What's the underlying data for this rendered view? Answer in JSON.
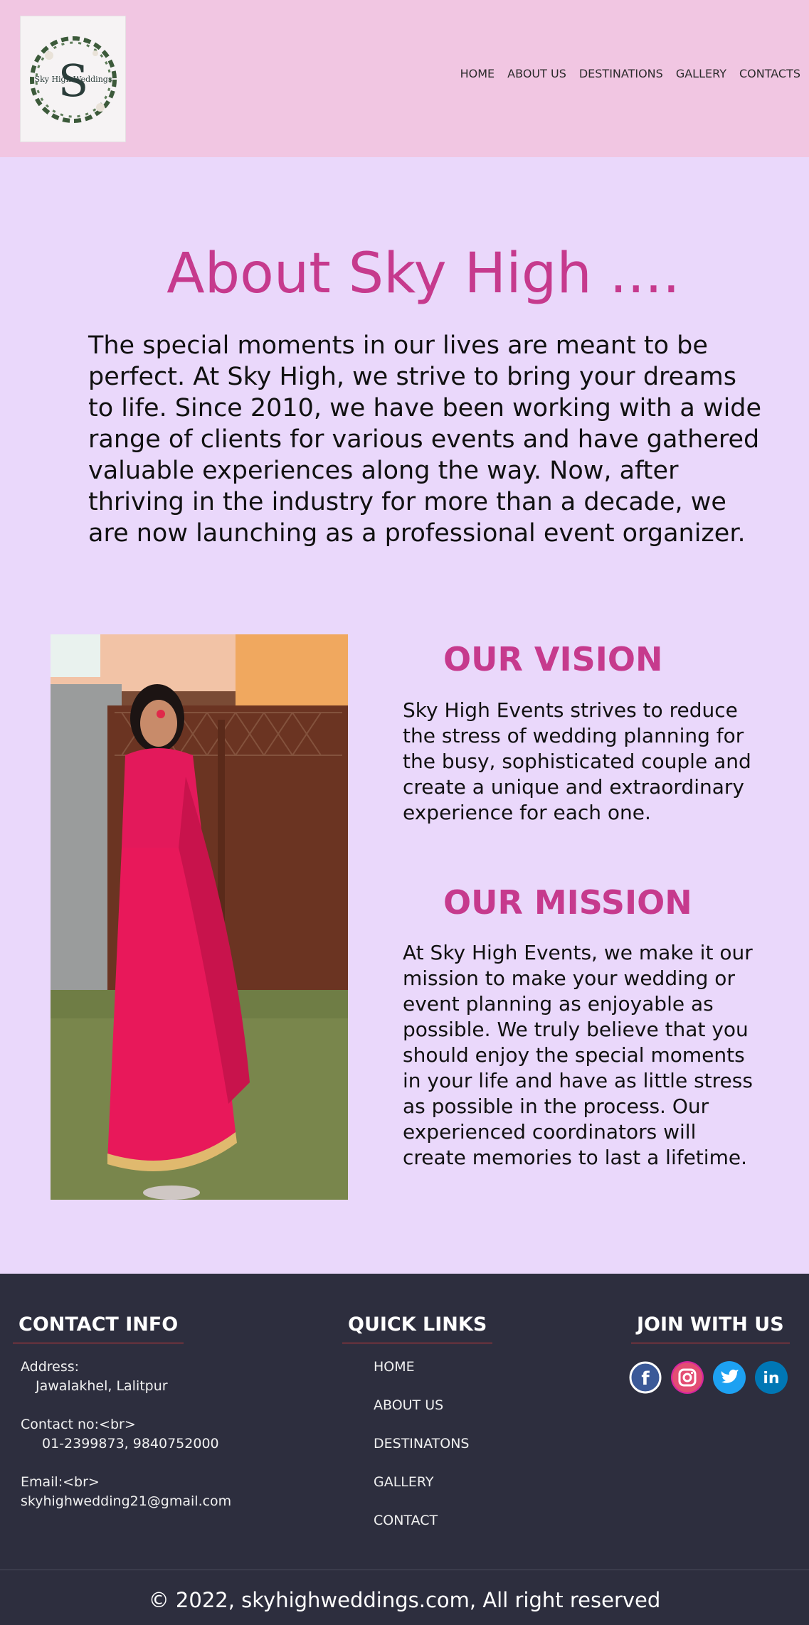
{
  "header": {
    "logo_text": "Sky High Weddings",
    "nav": [
      {
        "label": "HOME"
      },
      {
        "label": "ABOUT US"
      },
      {
        "label": "DESTINATIONS"
      },
      {
        "label": "GALLERY"
      },
      {
        "label": "CONTACTS"
      }
    ]
  },
  "about": {
    "title": "About Sky High ....",
    "text": "The special moments in our lives are meant to be perfect. At Sky High, we strive to bring your dreams to life. Since 2010, we have been working with a wide range of clients for various events and have gathered valuable experiences along the way. Now, after thriving in the industry for more than  a decade, we are now launching as a professional event organizer."
  },
  "vision": {
    "title": "OUR VISION",
    "text": "Sky High Events strives to reduce the stress of wedding planning for the busy, sophisticated couple and create a unique and extraordinary experience for each one."
  },
  "mission": {
    "title": "OUR MISSION",
    "text": "At Sky High Events, we make it our mission to make your wedding or event planning as enjoyable as possible. We truly believe that you should enjoy the special moments in your life and have as little stress as possible in the process. Our experienced coordinators will create memories to last a lifetime."
  },
  "footer": {
    "contact_title": "CONTACT INFO",
    "address_label": "Address:",
    "address_value": "Jawalakhel, Lalitpur",
    "contact_label": "Contact no:<br>",
    "contact_value": "01-2399873, 9840752000",
    "email_label": "Email:<br>",
    "email_value": "skyhighwedding21@gmail.com",
    "links_title": "QUICK LINKS",
    "links": [
      {
        "label": "HOME"
      },
      {
        "label": "ABOUT US"
      },
      {
        "label": "DESTINATONS"
      },
      {
        "label": "GALLERY"
      },
      {
        "label": "CONTACT"
      }
    ],
    "join_title": "JOIN WITH US",
    "social": [
      {
        "icon": "facebook-icon",
        "color": "#3b5998"
      },
      {
        "icon": "instagram-icon",
        "color": "#d6249f"
      },
      {
        "icon": "twitter-icon",
        "color": "#1da1f2"
      },
      {
        "icon": "linkedin-icon",
        "color": "#0077b5"
      }
    ],
    "copyright": "© 2022, skyhighweddings.com, All right reserved"
  },
  "colors": {
    "header_bg": "#f1c6e2",
    "page_bg": "#ead8fb",
    "accent": "#c63a8d",
    "footer_bg": "#2d2e3e"
  }
}
